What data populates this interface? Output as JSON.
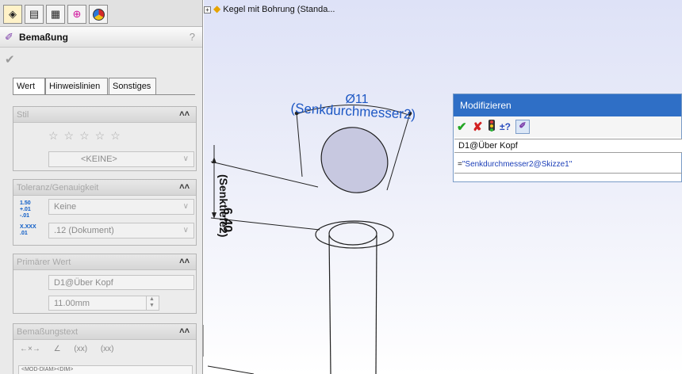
{
  "tree": {
    "item_label": "Kegel mit Bohrung  (Standa..."
  },
  "property_manager": {
    "title": "Bemaßung",
    "help": "?",
    "tabs": [
      "Wert",
      "Hinweislinien",
      "Sonstiges"
    ],
    "stil": {
      "header": "Stil",
      "style_value": "<KEINE>"
    },
    "toleranz": {
      "header": "Toleranz/Genauigkeit",
      "tolerance_icon": "1.50 +.01 -.01",
      "tolerance_value": "Keine",
      "precision_icon": "X.XXX .01",
      "precision_value": ".12 (Dokument)"
    },
    "primaer": {
      "header": "Primärer Wert",
      "name_value": "D1@Über Kopf",
      "number_value": "11.00mm"
    },
    "text": {
      "header": "Bemaßungstext",
      "icon_xx1": "(xx)",
      "icon_xx2": "(xx)",
      "text_value": "<MOD-DIAM><DIM>"
    }
  },
  "graphics": {
    "diameter_label": "Ø11",
    "diameter_name": "(Senkdurchmesser2)",
    "depth_value": "6.40",
    "depth_name": "(Senktiefe2)"
  },
  "modify_dialog": {
    "title": "Modifizieren",
    "name_field": "D1@Über Kopf",
    "equation_sign": "=",
    "equation": "\"Senkdurchmesser2@Skizze1\""
  },
  "colors": {
    "dimension_blue": "#1d57c4",
    "title_bar": "#2f6fc6",
    "cancel_red": "#d32020",
    "ok_green": "#23a623"
  }
}
